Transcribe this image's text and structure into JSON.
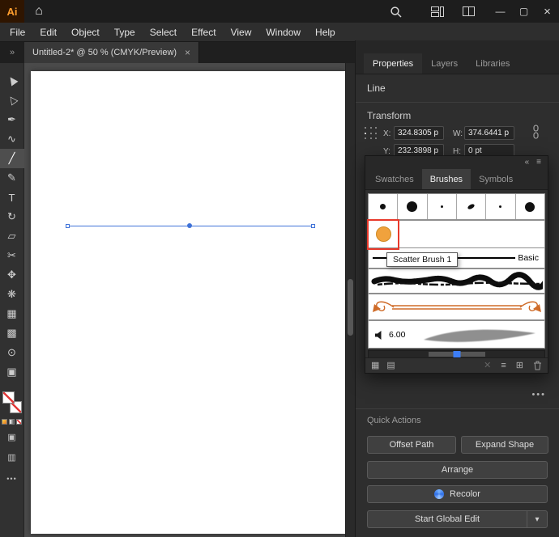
{
  "colors": {
    "selection_blue": "#3f72d8",
    "accent_blue": "#3d7ef7",
    "highlight_red": "#e8392b",
    "scatter_orange": "#f0a23d",
    "art_brush_orange": "#cf6b28",
    "logo_orange": "#ff9e2e"
  },
  "titlebar": {
    "logo_text": "Ai",
    "home_glyph": "⌂",
    "minimize_glyph": "—",
    "maximize_glyph": "▢",
    "close_glyph": "×"
  },
  "menubar": {
    "items": [
      "File",
      "Edit",
      "Object",
      "Type",
      "Select",
      "Effect",
      "View",
      "Window",
      "Help"
    ]
  },
  "doc_tabbar": {
    "collapse_glyph": "»",
    "tab_title": "Untitled-2* @ 50 % (CMYK/Preview)",
    "tab_close_glyph": "×"
  },
  "toolbar": {
    "tools": [
      {
        "name": "selection",
        "glyph": "▶"
      },
      {
        "name": "direct-selection",
        "glyph": "▷"
      },
      {
        "name": "pen",
        "glyph": "✒"
      },
      {
        "name": "curvature",
        "glyph": "∿"
      },
      {
        "name": "line-segment",
        "glyph": "╱",
        "selected": true
      },
      {
        "name": "paintbrush",
        "glyph": "✎"
      },
      {
        "name": "type",
        "glyph": "T"
      },
      {
        "name": "rotate",
        "glyph": "↻"
      },
      {
        "name": "eraser",
        "glyph": "▱"
      },
      {
        "name": "scissors",
        "glyph": "✂"
      },
      {
        "name": "hand",
        "glyph": "✥"
      },
      {
        "name": "blend",
        "glyph": "❋"
      },
      {
        "name": "mesh",
        "glyph": "▦"
      },
      {
        "name": "shape-builder",
        "glyph": "▩"
      },
      {
        "name": "zoom",
        "glyph": "⊙"
      },
      {
        "name": "artboard",
        "glyph": "▣"
      }
    ],
    "overflow_glyph": "•••"
  },
  "properties": {
    "tabs": [
      "Properties",
      "Layers",
      "Libraries"
    ],
    "active_tab": "Properties",
    "selection_label": "Line",
    "transform": {
      "title": "Transform",
      "x_label": "X:",
      "x_value": "324.8305 p",
      "y_label": "Y:",
      "y_value": "232.3898 p",
      "w_label": "W:",
      "w_value": "374.6441 p",
      "h_label": "H:",
      "h_value": "0 pt"
    },
    "more_options_glyph": "•••",
    "quick_actions": {
      "title": "Quick Actions",
      "offset_path": "Offset Path",
      "expand_shape": "Expand Shape",
      "arrange": "Arrange",
      "recolor": "Recolor",
      "start_global_edit": "Start Global Edit",
      "dropdown_glyph": "▾"
    }
  },
  "brushes": {
    "collapse_glyph": "«",
    "menu_glyph": "≡",
    "tabs": [
      "Swatches",
      "Brushes",
      "Symbols"
    ],
    "active_tab": "Brushes",
    "tooltip": "Scatter Brush 1",
    "rows": {
      "basic_label": "Basic",
      "calligraphic_size": "6.00"
    },
    "footer": {
      "brush_libraries_glyph": "▦",
      "libraries_panel_glyph": "▤",
      "remove_glyph": "✕",
      "options_glyph": "≡",
      "new_glyph": "⊞"
    }
  }
}
